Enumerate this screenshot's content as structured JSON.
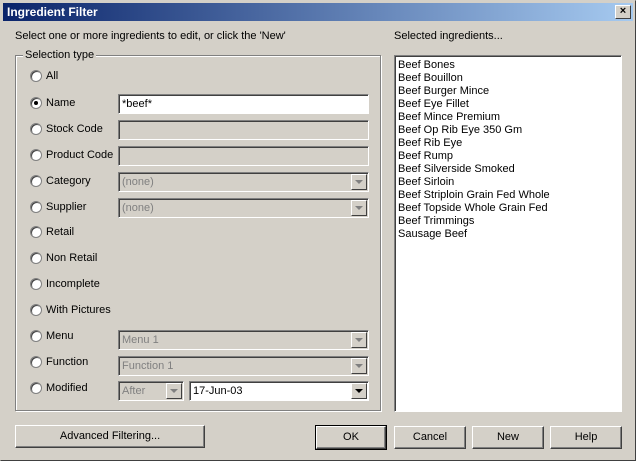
{
  "window": {
    "title": "Ingredient Filter",
    "close_glyph": "×"
  },
  "instruction": "Select one or more ingredients to edit, or click the 'New'",
  "selected_label": "Selected ingredients...",
  "selection_group_title": "Selection type",
  "options": [
    {
      "key": "all",
      "label": "All",
      "checked": false
    },
    {
      "key": "name",
      "label": "Name",
      "checked": true
    },
    {
      "key": "stock_code",
      "label": "Stock Code",
      "checked": false
    },
    {
      "key": "product_code",
      "label": "Product Code",
      "checked": false
    },
    {
      "key": "category",
      "label": "Category",
      "checked": false
    },
    {
      "key": "supplier",
      "label": "Supplier",
      "checked": false
    },
    {
      "key": "retail",
      "label": "Retail",
      "checked": false
    },
    {
      "key": "non_retail",
      "label": "Non Retail",
      "checked": false
    },
    {
      "key": "incomplete",
      "label": "Incomplete",
      "checked": false
    },
    {
      "key": "with_pictures",
      "label": "With Pictures",
      "checked": false
    },
    {
      "key": "menu",
      "label": "Menu",
      "checked": false
    },
    {
      "key": "function",
      "label": "Function",
      "checked": false
    },
    {
      "key": "modified",
      "label": "Modified",
      "checked": false
    }
  ],
  "fields": {
    "name_value": "*beef*",
    "stock_code_value": "",
    "product_code_value": "",
    "category_value": "(none)",
    "supplier_value": "(none)",
    "menu_value": "Menu 1",
    "function_value": "Function 1",
    "modified_comparator": "After",
    "modified_date": "17-Jun-03"
  },
  "ingredients": [
    "Beef Bones",
    "Beef Bouillon",
    "Beef Burger Mince",
    "Beef Eye Fillet",
    "Beef Mince Premium",
    "Beef Op Rib Eye 350 Gm",
    "Beef Rib Eye",
    "Beef Rump",
    "Beef Silverside Smoked",
    "Beef Sirloin",
    "Beef Striploin Grain Fed Whole",
    "Beef Topside Whole Grain Fed",
    "Beef Trimmings",
    "Sausage Beef"
  ],
  "buttons": {
    "advanced": "Advanced Filtering...",
    "ok": "OK",
    "cancel": "Cancel",
    "new": "New",
    "help": "Help"
  }
}
